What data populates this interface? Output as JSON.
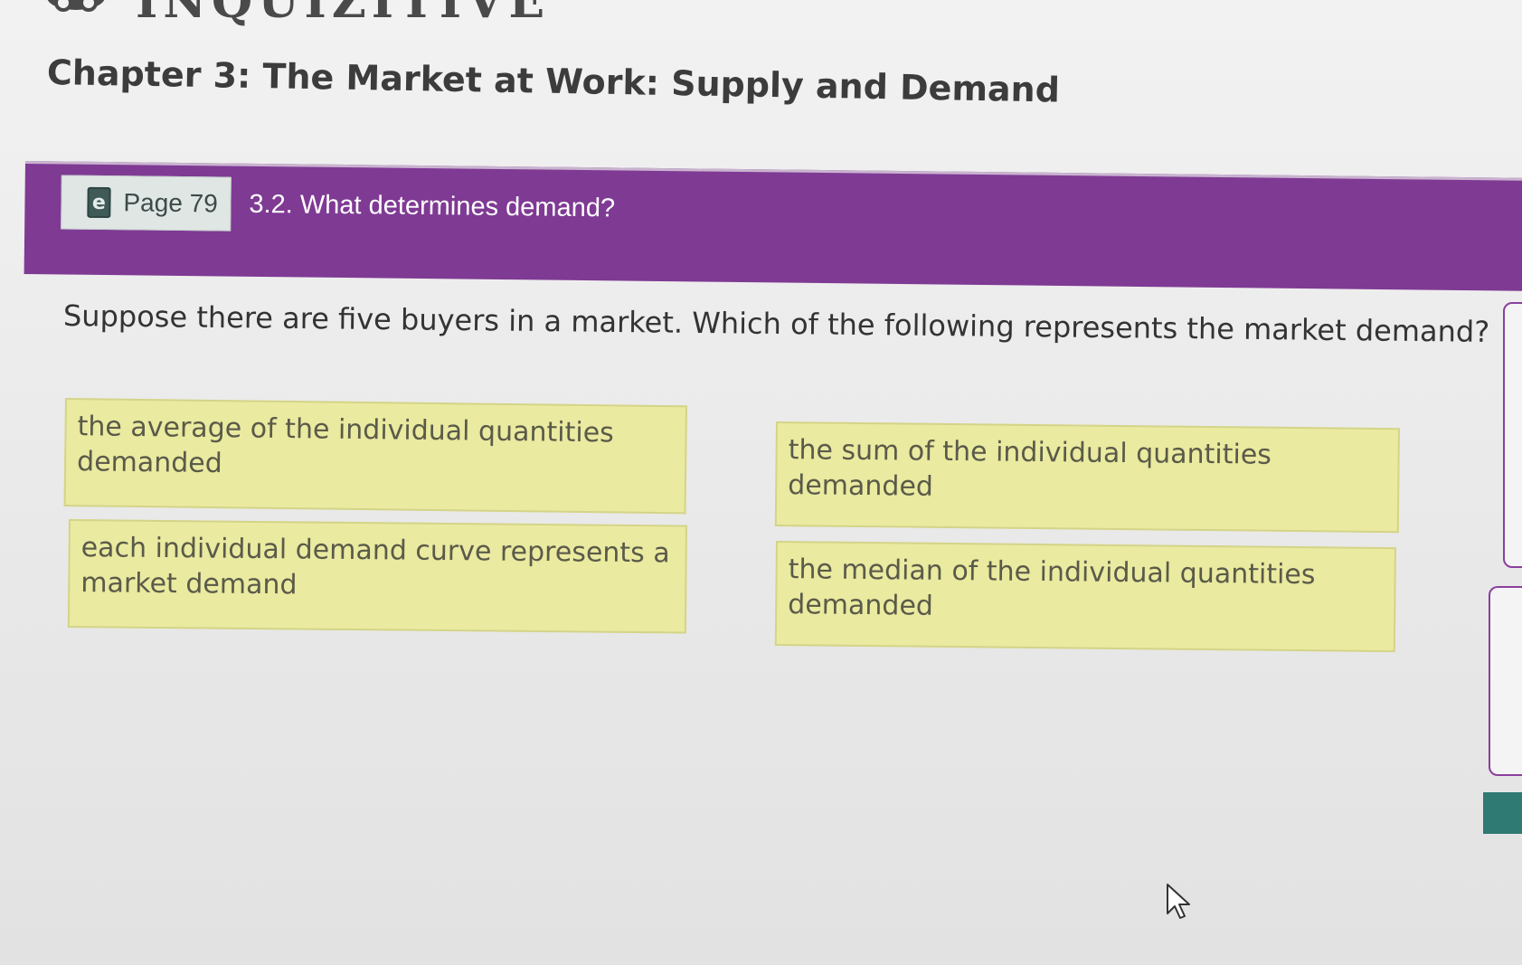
{
  "app": {
    "logo_text": "INQUIZITIVE"
  },
  "header": {
    "chapter_title": "Chapter 3: The Market at Work: Supply and Demand"
  },
  "banner": {
    "page_label": "Page 79",
    "section_label": "3.2. What determines demand?",
    "color": "#7f3a94"
  },
  "question": {
    "text": "Suppose there are five buyers in a market. Which of the following represents the market demand?"
  },
  "options": [
    {
      "label": "the average of the individual quantities demanded"
    },
    {
      "label": "the sum of the individual quantities demanded"
    },
    {
      "label": "each individual demand curve represents a market demand"
    },
    {
      "label": "the median of the individual quantities demanded"
    }
  ],
  "colors": {
    "option_fill": "#eaeaa0",
    "accent_teal": "#2f7a72",
    "accent_purple": "#8a3f9e"
  },
  "icons": {
    "logo": "brain-gears-icon",
    "ebook": "ebook-icon",
    "cursor": "mouse-pointer-icon"
  }
}
